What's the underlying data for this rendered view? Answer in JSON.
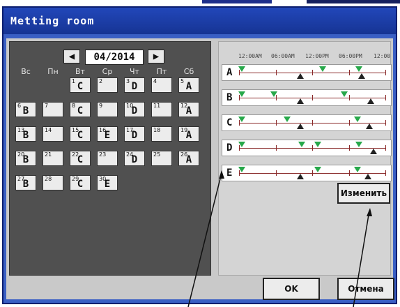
{
  "window": {
    "title": "Metting room"
  },
  "calendar": {
    "month": "04/2014",
    "prev_icon": "left-arrow",
    "next_icon": "right-arrow",
    "weekdays": [
      "Вс",
      "Пн",
      "Вт",
      "Ср",
      "Чт",
      "Пт",
      "Сб"
    ],
    "days": [
      {
        "day": "1",
        "pattern": "C"
      },
      {
        "day": "2",
        "pattern": ""
      },
      {
        "day": "3",
        "pattern": "D"
      },
      {
        "day": "4",
        "pattern": ""
      },
      {
        "day": "5",
        "pattern": "A"
      },
      {
        "day": "6",
        "pattern": "B"
      },
      {
        "day": "7",
        "pattern": ""
      },
      {
        "day": "8",
        "pattern": "C"
      },
      {
        "day": "9",
        "pattern": ""
      },
      {
        "day": "10",
        "pattern": "D"
      },
      {
        "day": "11",
        "pattern": ""
      },
      {
        "day": "12",
        "pattern": "A"
      },
      {
        "day": "13",
        "pattern": "B"
      },
      {
        "day": "14",
        "pattern": ""
      },
      {
        "day": "15",
        "pattern": "C"
      },
      {
        "day": "16",
        "pattern": "E"
      },
      {
        "day": "17",
        "pattern": "D"
      },
      {
        "day": "18",
        "pattern": ""
      },
      {
        "day": "19",
        "pattern": "A"
      },
      {
        "day": "20",
        "pattern": "B"
      },
      {
        "day": "21",
        "pattern": ""
      },
      {
        "day": "22",
        "pattern": "C"
      },
      {
        "day": "23",
        "pattern": ""
      },
      {
        "day": "24",
        "pattern": "D"
      },
      {
        "day": "25",
        "pattern": ""
      },
      {
        "day": "26",
        "pattern": "A"
      },
      {
        "day": "27",
        "pattern": "B"
      },
      {
        "day": "28",
        "pattern": ""
      },
      {
        "day": "29",
        "pattern": "C"
      },
      {
        "day": "30",
        "pattern": "E"
      }
    ]
  },
  "schedule": {
    "time_labels": [
      "12:00AM",
      "06:00AM",
      "12:00PM",
      "06:00PM",
      "12:00"
    ],
    "patterns": [
      {
        "name": "A",
        "on": [
          0.02,
          0.57,
          0.82
        ],
        "off": [
          0.42,
          0.84
        ]
      },
      {
        "name": "B",
        "on": [
          0.02,
          0.24,
          0.72
        ],
        "off": [
          0.42,
          0.9
        ]
      },
      {
        "name": "C",
        "on": [
          0.02,
          0.33,
          0.81
        ],
        "off": [
          0.42,
          0.89
        ]
      },
      {
        "name": "D",
        "on": [
          0.02,
          0.43,
          0.54,
          0.82
        ],
        "off": [
          0.92
        ]
      },
      {
        "name": "E",
        "on": [
          0.02,
          0.54,
          0.81
        ],
        "off": [
          0.42,
          0.88
        ]
      }
    ]
  },
  "buttons": {
    "edit": "Изменить",
    "ok": "OK",
    "cancel": "Отмена"
  },
  "colors": {
    "title_bar": "#2247ba",
    "calendar_bg": "#505050",
    "on_marker": "#27a84a",
    "off_marker": "#222222",
    "timeline": "#8a2a2a"
  }
}
